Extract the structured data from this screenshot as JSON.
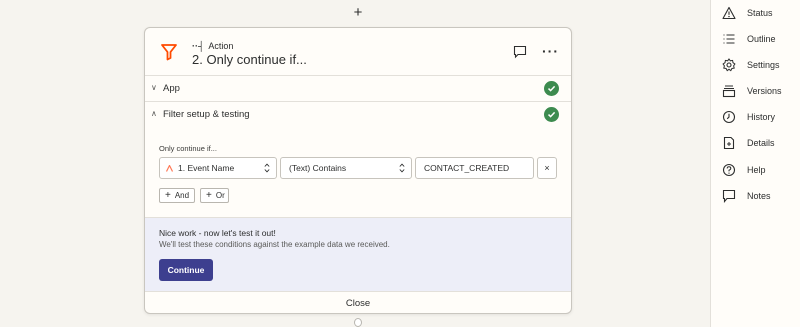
{
  "canvas": {
    "add_symbol": "+"
  },
  "step": {
    "type_label": "Action",
    "title": "2. Only continue if...",
    "icon": "filter-icon"
  },
  "sections": {
    "app": {
      "label": "App",
      "status": "complete"
    },
    "filter": {
      "label": "Filter setup & testing",
      "status": "complete"
    }
  },
  "filter": {
    "only_continue_label": "Only continue if...",
    "field": "1. Event Name",
    "operator": "(Text) Contains",
    "value": "CONTACT_CREATED",
    "remove_symbol": "×",
    "and_label": "And",
    "or_label": "Or"
  },
  "test": {
    "title": "Nice work - now let's test it out!",
    "description": "We'll test these conditions against the example data we received.",
    "continue_label": "Continue"
  },
  "close_label": "Close",
  "sidebar": {
    "items": [
      {
        "label": "Status",
        "icon": "warning-icon"
      },
      {
        "label": "Outline",
        "icon": "list-icon"
      },
      {
        "label": "Settings",
        "icon": "gear-icon"
      },
      {
        "label": "Versions",
        "icon": "stack-icon"
      },
      {
        "label": "History",
        "icon": "clock-icon"
      },
      {
        "label": "Details",
        "icon": "document-icon"
      },
      {
        "label": "Help",
        "icon": "help-icon"
      },
      {
        "label": "Notes",
        "icon": "note-icon"
      }
    ]
  },
  "colors": {
    "brand_orange": "#ff4a00",
    "success_green": "#3d8b4f",
    "continue_button": "#3d3f8f",
    "test_panel_bg": "#edeef8"
  }
}
